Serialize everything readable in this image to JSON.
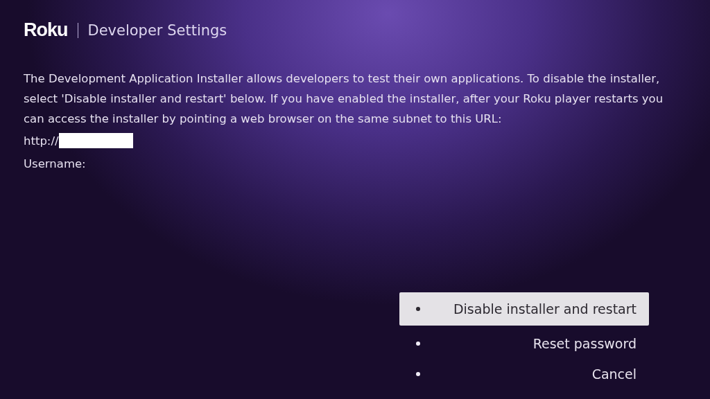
{
  "header": {
    "logo": "Roku",
    "title": "Developer Settings"
  },
  "description": "The Development Application Installer allows developers to test their own applications. To disable the installer, select 'Disable installer and restart' below. If you have enabled the installer, after your Roku player restarts you can access the installer by pointing a web browser on the same subnet to this URL:",
  "url_label": "http://",
  "username_label": "Username:",
  "menu": [
    {
      "label": "Disable installer and restart",
      "selected": true
    },
    {
      "label": "Reset password",
      "selected": false
    },
    {
      "label": "Cancel",
      "selected": false
    }
  ]
}
